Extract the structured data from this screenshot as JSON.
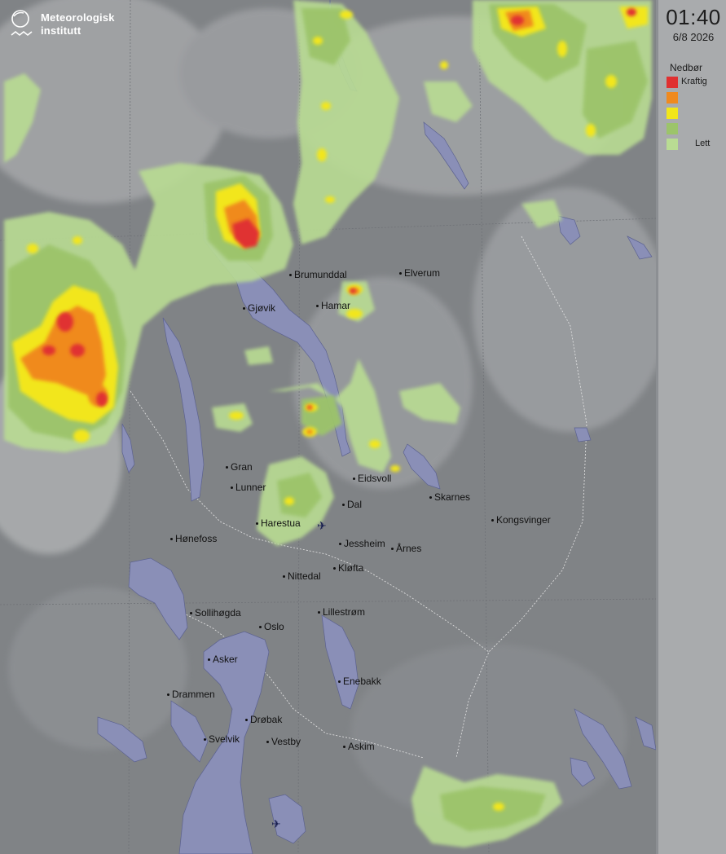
{
  "header": {
    "logo_line1": "Meteorologisk",
    "logo_line2": "institutt",
    "logo_icon": "met-logo-icon"
  },
  "timestamp": {
    "time": "01:40",
    "date": "6/8 2026"
  },
  "legend": {
    "title": "Nedbør",
    "items": [
      {
        "color": "#e03030",
        "label": "Kraftig"
      },
      {
        "color": "#f08a1e",
        "label": ""
      },
      {
        "color": "#f2e61a",
        "label": ""
      },
      {
        "color": "#9cc46a",
        "label": ""
      },
      {
        "color": "#b9dc93",
        "label": "Lett"
      }
    ]
  },
  "cities": [
    {
      "name": "Brumunddal"
    },
    {
      "name": "Elverum"
    },
    {
      "name": "Gjøvik"
    },
    {
      "name": "Hamar"
    },
    {
      "name": "Gran"
    },
    {
      "name": "Lunner"
    },
    {
      "name": "Eidsvoll"
    },
    {
      "name": "Skarnes"
    },
    {
      "name": "Dal"
    },
    {
      "name": "Harestua"
    },
    {
      "name": "Kongsvinger"
    },
    {
      "name": "Hønefoss"
    },
    {
      "name": "Jessheim"
    },
    {
      "name": "Årnes"
    },
    {
      "name": "Kløfta"
    },
    {
      "name": "Nittedal"
    },
    {
      "name": "Sollihøgda"
    },
    {
      "name": "Oslo"
    },
    {
      "name": "Lillestrøm"
    },
    {
      "name": "Asker"
    },
    {
      "name": "Enebakk"
    },
    {
      "name": "Drammen"
    },
    {
      "name": "Drøbak"
    },
    {
      "name": "Svelvik"
    },
    {
      "name": "Vestby"
    },
    {
      "name": "Askim"
    }
  ],
  "airports": [
    {
      "icon": "airplane-icon"
    },
    {
      "icon": "airplane-icon"
    }
  ],
  "colors": {
    "water": "#8a8fb7",
    "terrain_dark": "#7d8085",
    "terrain_light": "#b3b5b7"
  }
}
